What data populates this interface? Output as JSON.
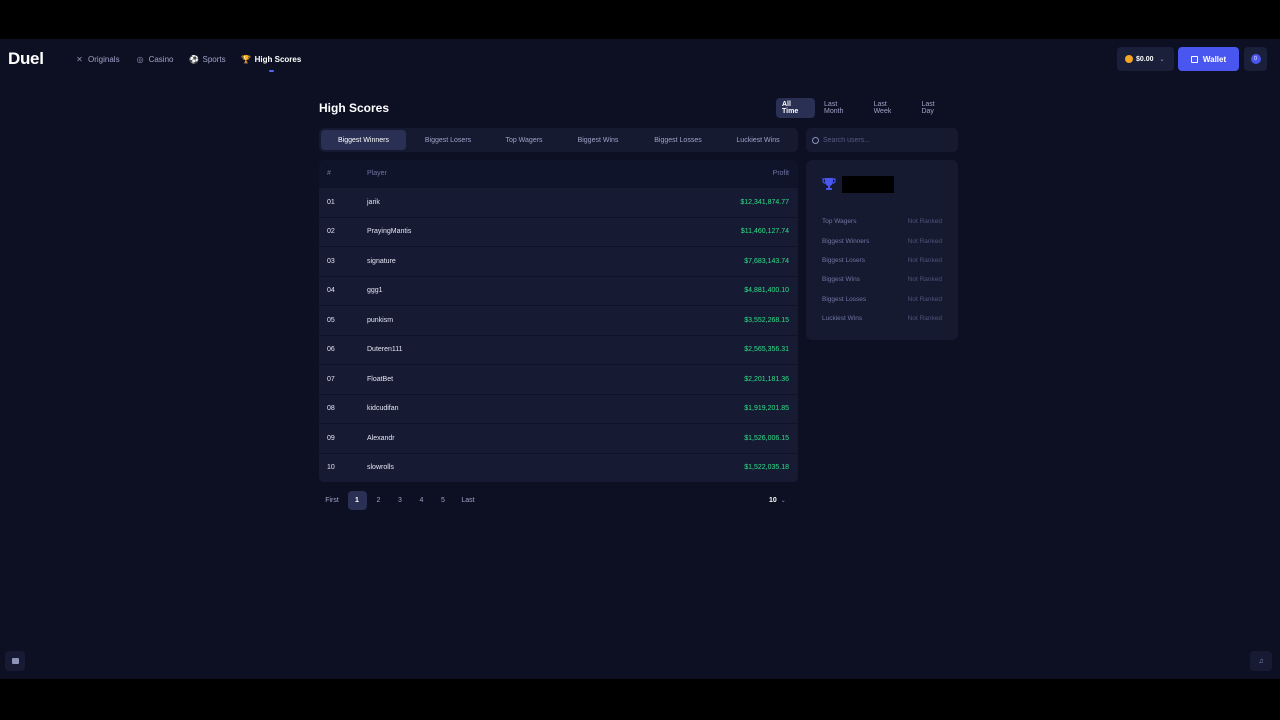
{
  "brand": {
    "logo_text": "Duel"
  },
  "nav": [
    {
      "label": "Originals",
      "icon": "✕"
    },
    {
      "label": "Casino",
      "icon": "◎"
    },
    {
      "label": "Sports",
      "icon": "⚽"
    },
    {
      "label": "High Scores",
      "icon": "🏆"
    }
  ],
  "header": {
    "balance": "$0.00",
    "wallet_label": "Wallet",
    "profile_badge": "0"
  },
  "page": {
    "title": "High Scores",
    "time_tabs": [
      "All Time",
      "Last Month",
      "Last Week",
      "Last Day"
    ],
    "category_tabs": [
      "Biggest Winners",
      "Biggest Losers",
      "Top Wagers",
      "Biggest Wins",
      "Biggest Losses",
      "Luckiest Wins"
    ],
    "search_placeholder": "Search users..."
  },
  "table": {
    "columns": {
      "rank": "#",
      "player": "Player",
      "profit": "Profit"
    },
    "rows": [
      {
        "rank": "01",
        "player": "jarik",
        "profit": "$12,341,874.77"
      },
      {
        "rank": "02",
        "player": "PrayingMantis",
        "profit": "$11,460,127.74"
      },
      {
        "rank": "03",
        "player": "signature",
        "profit": "$7,683,143.74"
      },
      {
        "rank": "04",
        "player": "ggg1",
        "profit": "$4,881,400.10"
      },
      {
        "rank": "05",
        "player": "punkism",
        "profit": "$3,552,268.15"
      },
      {
        "rank": "06",
        "player": "Duteren111",
        "profit": "$2,565,356.31"
      },
      {
        "rank": "07",
        "player": "FloatBet",
        "profit": "$2,201,181.36"
      },
      {
        "rank": "08",
        "player": "kidcudifan",
        "profit": "$1,919,201.85"
      },
      {
        "rank": "09",
        "player": "Alexandr",
        "profit": "$1,526,006.15"
      },
      {
        "rank": "10",
        "player": "slowrolls",
        "profit": "$1,522,035.18"
      }
    ]
  },
  "pagination": {
    "first": "First",
    "pages": [
      "1",
      "2",
      "3",
      "4",
      "5"
    ],
    "last": "Last",
    "page_size": "10"
  },
  "side_panel": {
    "stats": [
      {
        "label": "Top Wagers",
        "value": "Not Ranked"
      },
      {
        "label": "Biggest Winners",
        "value": "Not Ranked"
      },
      {
        "label": "Biggest Losers",
        "value": "Not Ranked"
      },
      {
        "label": "Biggest Wins",
        "value": "Not Ranked"
      },
      {
        "label": "Biggest Losses",
        "value": "Not Ranked"
      },
      {
        "label": "Luckiest Wins",
        "value": "Not Ranked"
      }
    ]
  },
  "colors": {
    "accent": "#4a56f0",
    "profit": "#2ee088",
    "background": "#0d1023"
  }
}
